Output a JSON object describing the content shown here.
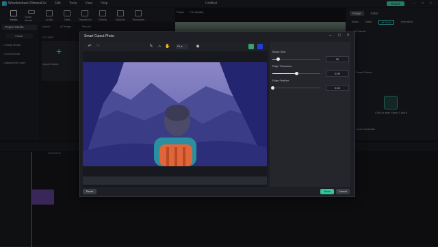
{
  "app": {
    "name": "Wondershare Filmora",
    "menus": [
      "File",
      "Edit",
      "Tools",
      "View",
      "Help"
    ],
    "document_title": "Untitled",
    "export_label": "Export"
  },
  "media_tabs": [
    {
      "label": "Media",
      "icon": "media-icon"
    },
    {
      "label": "Stock Media",
      "icon": "stock-media-icon"
    },
    {
      "label": "Audio",
      "icon": "audio-icon"
    },
    {
      "label": "Titles",
      "icon": "titles-icon"
    },
    {
      "label": "Transitions",
      "icon": "transitions-icon"
    },
    {
      "label": "Effects",
      "icon": "effects-icon"
    },
    {
      "label": "Stickers",
      "icon": "stickers-icon"
    },
    {
      "label": "Templates",
      "icon": "templates-icon"
    }
  ],
  "library": {
    "project_media": "Project Media",
    "folder": "Folder",
    "items": [
      "Global Media",
      "Cloud Media",
      "Adjustment Layer"
    ]
  },
  "media_area": {
    "filters": [
      "Import",
      "AI Image",
      "Record"
    ],
    "folder_label": "FOLDER",
    "import_label": "Import Media"
  },
  "player": {
    "tabs": [
      "Player",
      "Full Quality"
    ]
  },
  "properties": {
    "tabs": [
      "Image",
      "Color"
    ],
    "subtabs": [
      "Basic",
      "Mask",
      "AI Tools",
      "Animation"
    ],
    "ai_portrait": "AI Portrait",
    "smart_cutout": "Smart Cutout",
    "cutout_hint": "Click to start Smart Cutout",
    "lens_correction": "Lens Correction",
    "reset": "Reset"
  },
  "modal": {
    "title": "Smart Cutout Photo",
    "fit_label": "Fit",
    "brush_size_label": "Brush Size",
    "brush_size_value": "30",
    "edge_thickness_label": "Edge Thickness",
    "edge_thickness_value": "0.00",
    "edge_feather_label": "Edge Feather",
    "edge_feather_value": "0.00",
    "reset_label": "Reset",
    "save_label": "Save",
    "cancel_label": "Cancel",
    "swatch_green": "#3aa06d",
    "swatch_blue": "#1f3fd6",
    "brush_size_fraction": 0.12,
    "edge_thickness_fraction": 0.5,
    "edge_feather_fraction": 0.0
  },
  "timeline": {
    "ruler": [
      "00:00",
      "00:00:05:00",
      "00:00:10:00",
      "00:00:15:00",
      "00:00:20:00",
      "00:00:25:00",
      "00:00:30:00",
      "00:00:35:00",
      "00:00:40:00"
    ]
  }
}
